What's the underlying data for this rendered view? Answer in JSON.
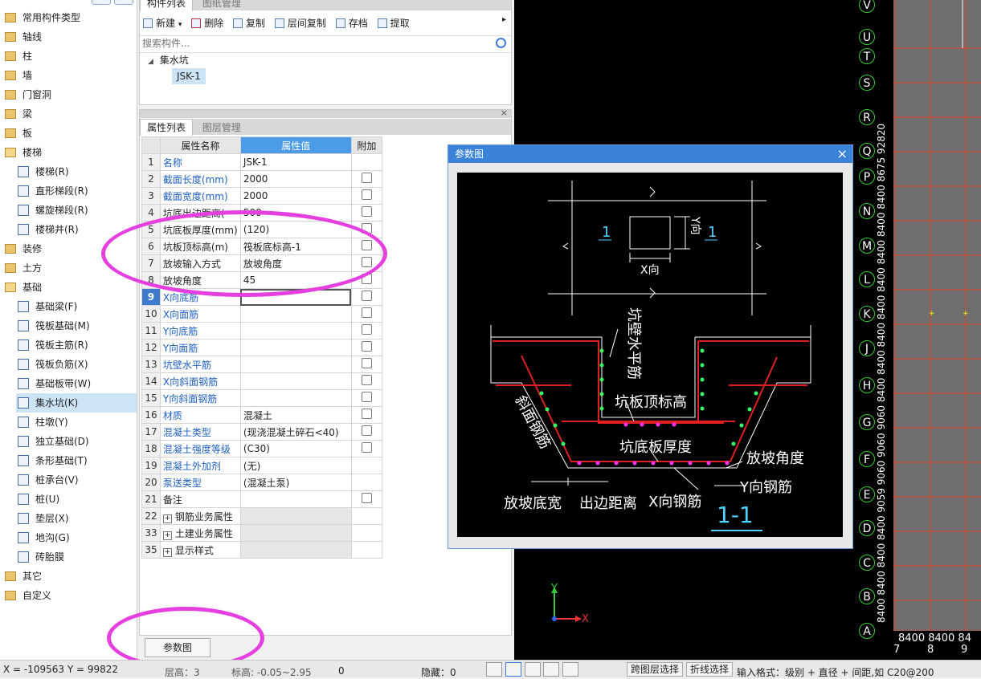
{
  "tree": {
    "items": [
      {
        "label": "常用构件类型",
        "kind": "folder",
        "indent": 0
      },
      {
        "label": "轴线",
        "kind": "folder",
        "indent": 0
      },
      {
        "label": "柱",
        "kind": "folder",
        "indent": 0
      },
      {
        "label": "墙",
        "kind": "folder",
        "indent": 0
      },
      {
        "label": "门窗洞",
        "kind": "folder",
        "indent": 0
      },
      {
        "label": "梁",
        "kind": "folder",
        "indent": 0
      },
      {
        "label": "板",
        "kind": "folder",
        "indent": 0
      },
      {
        "label": "楼梯",
        "kind": "folder-open",
        "indent": 0
      },
      {
        "label": "楼梯(R)",
        "kind": "item",
        "indent": 1
      },
      {
        "label": "直形梯段(R)",
        "kind": "item",
        "indent": 1
      },
      {
        "label": "螺旋梯段(R)",
        "kind": "item",
        "indent": 1
      },
      {
        "label": "楼梯井(R)",
        "kind": "item",
        "indent": 1
      },
      {
        "label": "装修",
        "kind": "folder",
        "indent": 0
      },
      {
        "label": "土方",
        "kind": "folder",
        "indent": 0
      },
      {
        "label": "基础",
        "kind": "folder-open",
        "indent": 0
      },
      {
        "label": "基础梁(F)",
        "kind": "item",
        "indent": 1
      },
      {
        "label": "筏板基础(M)",
        "kind": "item",
        "indent": 1
      },
      {
        "label": "筏板主筋(R)",
        "kind": "item",
        "indent": 1
      },
      {
        "label": "筏板负筋(X)",
        "kind": "item",
        "indent": 1
      },
      {
        "label": "基础板带(W)",
        "kind": "item",
        "indent": 1
      },
      {
        "label": "集水坑(K)",
        "kind": "item",
        "indent": 1,
        "selected": true
      },
      {
        "label": "柱墩(Y)",
        "kind": "item",
        "indent": 1
      },
      {
        "label": "独立基础(D)",
        "kind": "item",
        "indent": 1
      },
      {
        "label": "条形基础(T)",
        "kind": "item",
        "indent": 1
      },
      {
        "label": "桩承台(V)",
        "kind": "item",
        "indent": 1
      },
      {
        "label": "桩(U)",
        "kind": "item",
        "indent": 1
      },
      {
        "label": "垫层(X)",
        "kind": "item",
        "indent": 1
      },
      {
        "label": "地沟(G)",
        "kind": "item",
        "indent": 1
      },
      {
        "label": "砖胎膜",
        "kind": "item",
        "indent": 1
      },
      {
        "label": "其它",
        "kind": "folder",
        "indent": 0
      },
      {
        "label": "自定义",
        "kind": "folder",
        "indent": 0
      }
    ]
  },
  "component_panel": {
    "tab_active": "构件列表",
    "tab_other": "图纸管理",
    "toolbar": {
      "new": "新建",
      "delete": "删除",
      "copy": "复制",
      "floor_copy": "层间复制",
      "save": "存档",
      "extract": "提取"
    },
    "search_placeholder": "搜索构件...",
    "group": "集水坑",
    "item": "JSK-1"
  },
  "property_panel": {
    "tab_active": "属性列表",
    "tab_other": "图层管理",
    "headers": {
      "name": "属性名称",
      "value": "属性值",
      "extra": "附加"
    },
    "rows": [
      {
        "n": "1",
        "name": "名称",
        "value": "JSK-1",
        "blue": true,
        "cb": false
      },
      {
        "n": "2",
        "name": "截面长度(mm)",
        "value": "2000",
        "blue": true,
        "cb": true
      },
      {
        "n": "3",
        "name": "截面宽度(mm)",
        "value": "2000",
        "blue": true,
        "cb": true
      },
      {
        "n": "4",
        "name": "坑底出边距离(",
        "value": "500",
        "blue": false,
        "cb": true
      },
      {
        "n": "5",
        "name": "坑底板厚度(mm)",
        "value": "(120)",
        "blue": false,
        "cb": true
      },
      {
        "n": "6",
        "name": "坑板顶标高(m)",
        "value": "筏板底标高-1",
        "blue": false,
        "cb": true
      },
      {
        "n": "7",
        "name": "放坡输入方式",
        "value": "放坡角度",
        "blue": false,
        "cb": true
      },
      {
        "n": "8",
        "name": "放坡角度",
        "value": "45",
        "blue": false,
        "cb": true
      },
      {
        "n": "9",
        "name": "X向底筋",
        "value": "",
        "blue": true,
        "cb": true,
        "selected": true
      },
      {
        "n": "10",
        "name": "X向面筋",
        "value": "",
        "blue": true,
        "cb": true
      },
      {
        "n": "11",
        "name": "Y向底筋",
        "value": "",
        "blue": true,
        "cb": true
      },
      {
        "n": "12",
        "name": "Y向面筋",
        "value": "",
        "blue": true,
        "cb": true
      },
      {
        "n": "13",
        "name": "坑壁水平筋",
        "value": "",
        "blue": true,
        "cb": true
      },
      {
        "n": "14",
        "name": "X向斜面钢筋",
        "value": "",
        "blue": true,
        "cb": true
      },
      {
        "n": "15",
        "name": "Y向斜面钢筋",
        "value": "",
        "blue": true,
        "cb": true
      },
      {
        "n": "16",
        "name": "材质",
        "value": "混凝土",
        "blue": true,
        "cb": true
      },
      {
        "n": "17",
        "name": "混凝土类型",
        "value": "(现浇混凝土碎石<40)",
        "blue": true,
        "cb": true
      },
      {
        "n": "18",
        "name": "混凝土强度等级",
        "value": "(C30)",
        "blue": true,
        "cb": true
      },
      {
        "n": "19",
        "name": "混凝土外加剂",
        "value": "(无)",
        "blue": true,
        "cb": false
      },
      {
        "n": "20",
        "name": "泵送类型",
        "value": "(混凝土泵)",
        "blue": true,
        "cb": false
      },
      {
        "n": "21",
        "name": "备注",
        "value": "",
        "blue": false,
        "cb": true
      },
      {
        "n": "22",
        "name": "钢筋业务属性",
        "value": "",
        "blue": false,
        "cb": false,
        "group": true
      },
      {
        "n": "33",
        "name": "土建业务属性",
        "value": "",
        "blue": false,
        "cb": false,
        "group": true
      },
      {
        "n": "35",
        "name": "显示样式",
        "value": "",
        "blue": false,
        "cb": false,
        "group": true
      }
    ],
    "param_button": "参数图"
  },
  "dialog": {
    "title": "参数图",
    "close": "×",
    "labels": {
      "section_mark": "1",
      "y_dir": "Y向",
      "x_dir": "X向",
      "wall_rebar": "坑壁水平筋",
      "top_elev": "坑板顶标高",
      "slope_rebar": "斜面钢筋",
      "bottom_thick": "坑底板厚度",
      "slope_angle": "放坡角度",
      "y_rebar": "Y向钢筋",
      "slope_width": "放坡底宽",
      "edge_dist": "出边距离",
      "x_rebar": "X向钢筋",
      "section_title": "1-1"
    }
  },
  "cad": {
    "axis_labels": [
      "V",
      "U",
      "T",
      "S",
      "R",
      "Q",
      "P",
      "N",
      "M",
      "L",
      "K",
      "J",
      "H",
      "G",
      "F",
      "E",
      "D",
      "C",
      "B",
      "A"
    ],
    "ruler_text": "8400 8400 8400 8400 9059 9060 9060 9060 8400 8400 8400 8400 8400 8400 8400 8400 8675 92820",
    "bottom_labels": [
      "7",
      "8",
      "9"
    ],
    "bottom_ruler": "8400 8400 84",
    "x_axis": "X",
    "y_axis": "Y"
  },
  "status": {
    "coords": "X = -109563 Y = 99822",
    "floor": "层高：3",
    "elev": "标高: -0.05~2.95",
    "zero": "0",
    "hidden": "隐藏：0",
    "cross_layer": "跨图层选择",
    "polyline": "折线选择",
    "hint": "输入格式：级别 + 直径 + 间距,如 C20@200"
  },
  "colors": {
    "highlight": "#e63fe0",
    "title_blue": "#3b83d8",
    "select_blue": "#3f7ccf"
  }
}
